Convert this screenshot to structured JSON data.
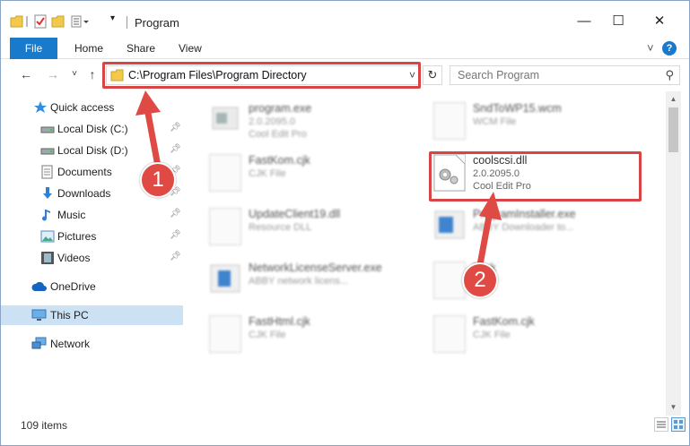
{
  "window": {
    "title": "Program",
    "minimize": "—",
    "maximize": "☐",
    "close": "✕"
  },
  "ribbon": {
    "tabs": [
      "File",
      "Home",
      "Share",
      "View"
    ],
    "expand_icon": "˅",
    "help_icon": "?"
  },
  "navigation": {
    "back": "←",
    "forward": "→",
    "recent": "˅",
    "up": "↑",
    "address": "C:\\Program Files\\Program Directory",
    "address_dropdown": "˅",
    "refresh": "↻",
    "search_placeholder": "Search Program",
    "search_icon": "⚲"
  },
  "sidebar": {
    "items": [
      {
        "label": "Quick access",
        "icon": "star-icon"
      },
      {
        "label": "Local Disk (C:)",
        "icon": "drive-icon",
        "pinned": true
      },
      {
        "label": "Local Disk (D:)",
        "icon": "drive-icon",
        "pinned": true
      },
      {
        "label": "Documents",
        "icon": "documents-icon",
        "pinned": true
      },
      {
        "label": "Downloads",
        "icon": "download-icon",
        "pinned": true
      },
      {
        "label": "Music",
        "icon": "music-icon",
        "pinned": true
      },
      {
        "label": "Pictures",
        "icon": "pictures-icon",
        "pinned": true
      },
      {
        "label": "Videos",
        "icon": "videos-icon",
        "pinned": true
      },
      {
        "label": "OneDrive",
        "icon": "cloud-icon"
      },
      {
        "label": "This PC",
        "icon": "computer-icon",
        "selected": true
      },
      {
        "label": "Network",
        "icon": "network-icon"
      }
    ]
  },
  "files": [
    {
      "name": "program.exe",
      "type": "2.0.2095.0",
      "desc": "Cool Edit Pro"
    },
    {
      "name": "SndToWP15.wcm",
      "type": "WCM File",
      "desc": ""
    },
    {
      "name": "FastKom.cjk",
      "type": "CJK File",
      "desc": ""
    },
    {
      "name": "coolscsi.dll",
      "type": "2.0.2095.0",
      "desc": "Cool Edit Pro"
    },
    {
      "name": "UpdateClient19.dll",
      "type": "Resource DLL",
      "desc": ""
    },
    {
      "name": "ProgramInstaller.exe",
      "type": "ABBY Downloader to...",
      "desc": ""
    },
    {
      "name": "NetworkLicenseServer.exe",
      "type": "ABBY network licens...",
      "desc": ""
    },
    {
      "name": "Task",
      "type": "File",
      "desc": ""
    },
    {
      "name": "FastHtml.cjk",
      "type": "CJK File",
      "desc": ""
    },
    {
      "name": "FastKom.cjk",
      "type": "CJK File",
      "desc": ""
    }
  ],
  "status": {
    "count": "109 items"
  },
  "annotations": {
    "step1": "1",
    "step2": "2",
    "color": "#d94545"
  }
}
